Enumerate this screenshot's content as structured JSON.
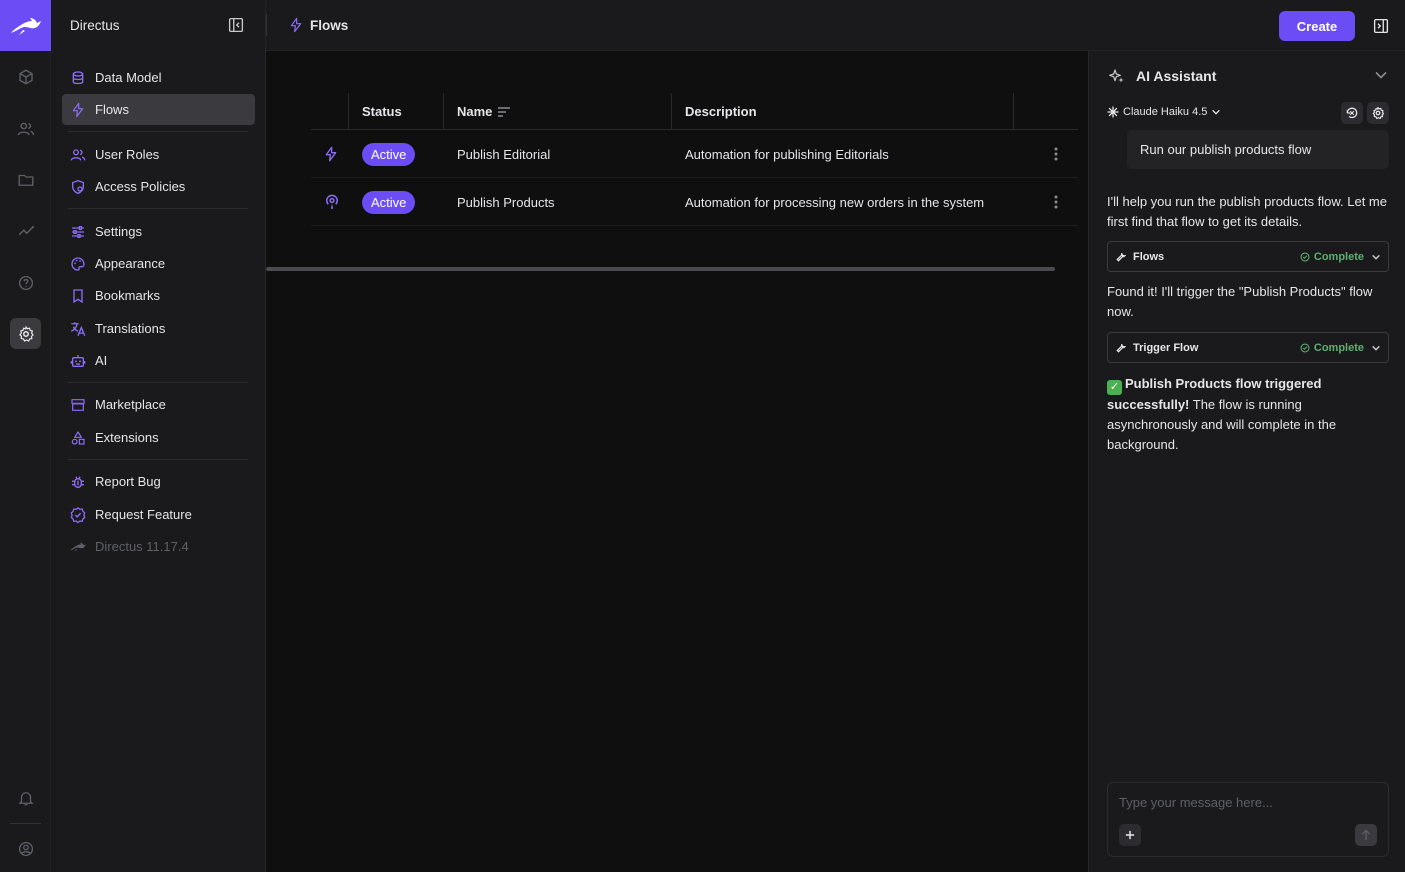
{
  "app": {
    "name": "Directus"
  },
  "header": {
    "breadcrumb": "Flows",
    "create_label": "Create"
  },
  "colors": {
    "accent": "#6c4cf5",
    "complete": "#5fae6f"
  },
  "nav": {
    "items": [
      {
        "label": "Data Model",
        "icon": "database-icon"
      },
      {
        "label": "Flows",
        "icon": "bolt-icon"
      },
      {
        "label": "User Roles",
        "icon": "users-icon"
      },
      {
        "label": "Access Policies",
        "icon": "shield-icon"
      },
      {
        "label": "Settings",
        "icon": "sliders-icon"
      },
      {
        "label": "Appearance",
        "icon": "palette-icon"
      },
      {
        "label": "Bookmarks",
        "icon": "bookmark-icon"
      },
      {
        "label": "Translations",
        "icon": "translate-icon"
      },
      {
        "label": "AI",
        "icon": "robot-icon"
      },
      {
        "label": "Marketplace",
        "icon": "storefront-icon"
      },
      {
        "label": "Extensions",
        "icon": "shapes-icon"
      },
      {
        "label": "Report Bug",
        "icon": "bug-icon"
      },
      {
        "label": "Request Feature",
        "icon": "verified-icon"
      },
      {
        "label": "Directus 11.17.4",
        "icon": "directus-rabbit-icon"
      }
    ]
  },
  "table": {
    "columns": [
      "Status",
      "Name",
      "Description"
    ],
    "rows": [
      {
        "icon": "bolt-icon",
        "status": "Active",
        "name": "Publish Editorial",
        "description": "Automation for publishing Editorials"
      },
      {
        "icon": "podcast-icon",
        "status": "Active",
        "name": "Publish Products",
        "description": "Automation for processing new orders in the system"
      }
    ]
  },
  "ai": {
    "title": "AI Assistant",
    "model": "Claude Haiku 4.5",
    "user_message": "Run our publish products flow",
    "reply_1": "I'll help you run the publish products flow. Let me first find that flow to get its details.",
    "tool_1": {
      "name": "Flows",
      "status": "Complete"
    },
    "reply_2": "Found it! I'll trigger the \"Publish Products\" flow now.",
    "tool_2": {
      "name": "Trigger Flow",
      "status": "Complete"
    },
    "reply_3_bold": "Publish Products flow triggered successfully!",
    "reply_3_rest": " The flow is running asynchronously and will complete in the background.",
    "input_placeholder": "Type your message here..."
  }
}
